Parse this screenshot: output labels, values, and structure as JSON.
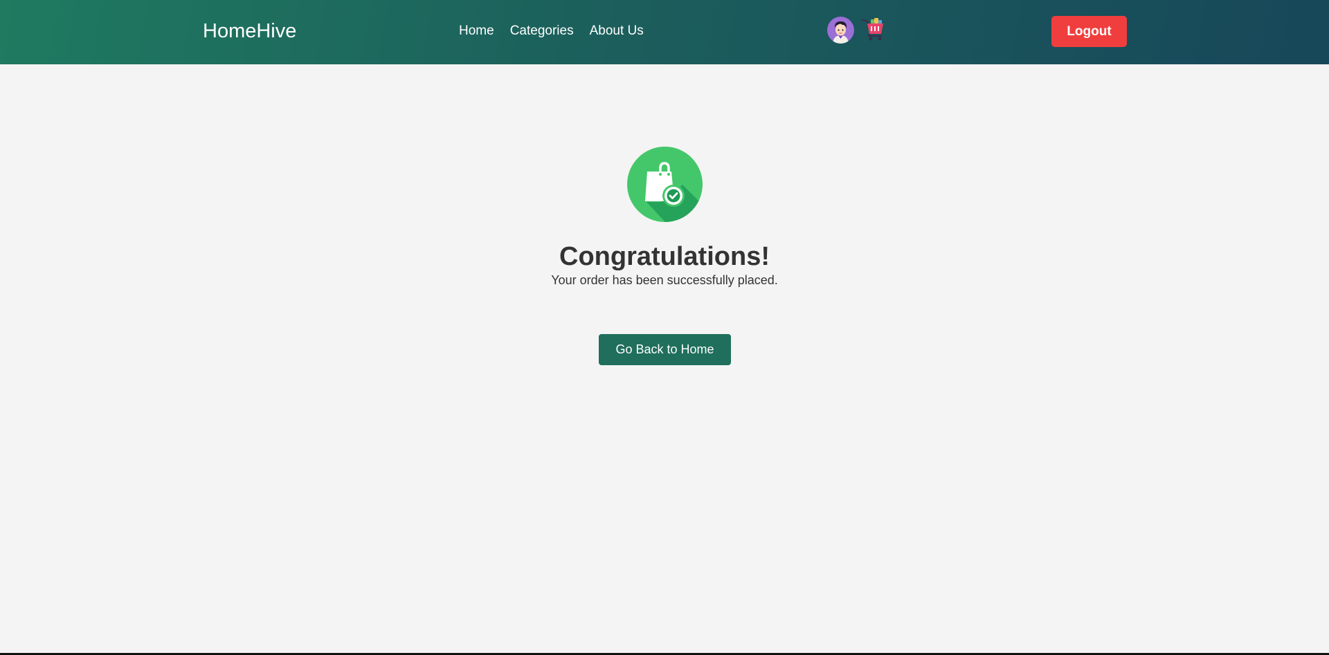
{
  "navbar": {
    "brand": "HomeHive",
    "links": [
      {
        "label": "Home"
      },
      {
        "label": "Categories"
      },
      {
        "label": "About Us"
      }
    ],
    "avatar_icon": "user-avatar-icon",
    "cart_icon": "shopping-cart-icon",
    "logout_label": "Logout"
  },
  "main": {
    "success_icon": "shopping-bag-check-icon",
    "title": "Congratulations!",
    "message": "Your order has been successfully placed.",
    "home_button_label": "Go Back to Home"
  },
  "colors": {
    "navbar_gradient_start": "#1f7a60",
    "navbar_gradient_end": "#17475a",
    "logout": "#f03e3e",
    "primary_button": "#1f6f5c",
    "success_circle": "#44c76a",
    "background": "#f4f4f4"
  }
}
